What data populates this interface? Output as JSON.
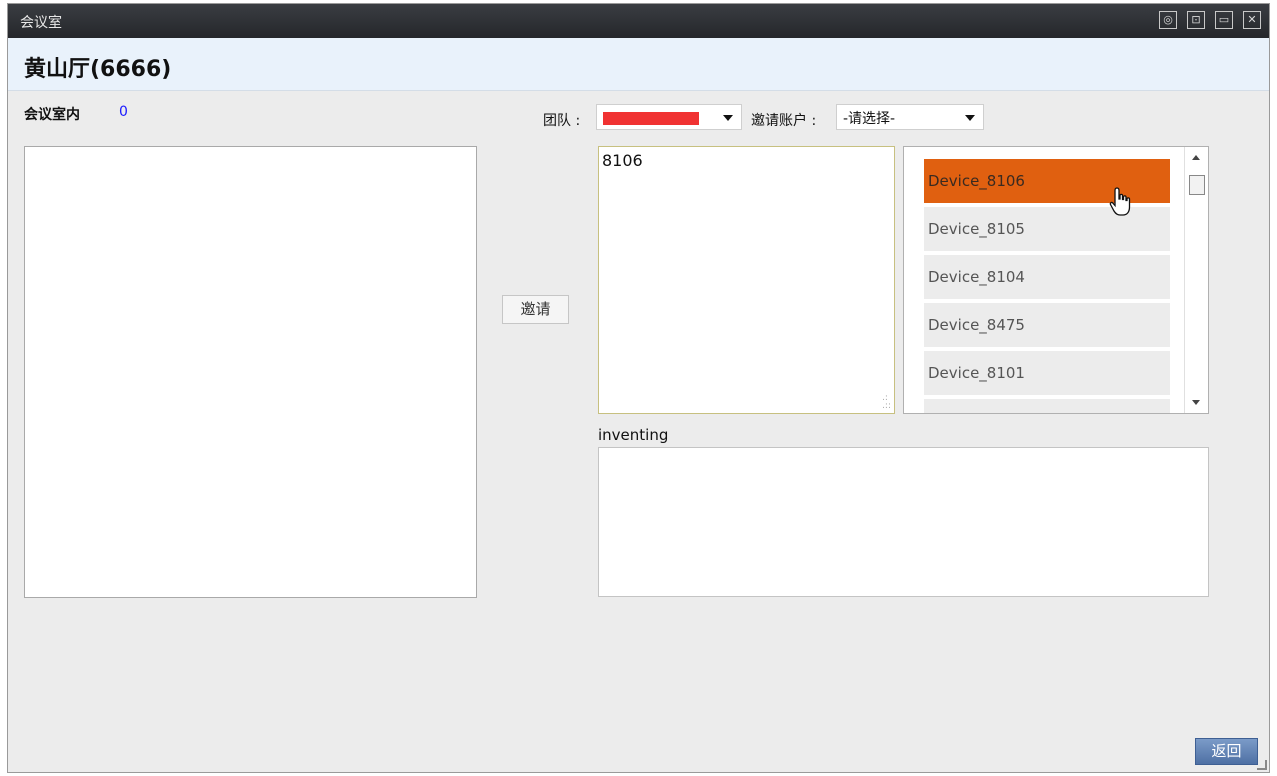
{
  "window": {
    "title": "会议室",
    "buttons": [
      "◎",
      "⊡",
      "▭",
      "✕"
    ]
  },
  "header": {
    "room_title": "黄山厅(6666)"
  },
  "left": {
    "label": "会议室内",
    "count": "0"
  },
  "filters": {
    "team_label": "团队 :",
    "account_label": "邀请账户 :",
    "account_value": "-请选择-"
  },
  "invite_button": "邀请",
  "input_text": "8106",
  "devices": [
    "Device_8106",
    "Device_8105",
    "Device_8104",
    "Device_8475",
    "Device_8101"
  ],
  "inviting_label": "inventing",
  "return_button": "返回",
  "colors": {
    "selected": "#e06010",
    "title_bar": "#2c2f33",
    "header_band": "#e9f2fb",
    "return_button": "#5a7db2",
    "count": "#1a1aff",
    "redacted": "#f03232"
  }
}
